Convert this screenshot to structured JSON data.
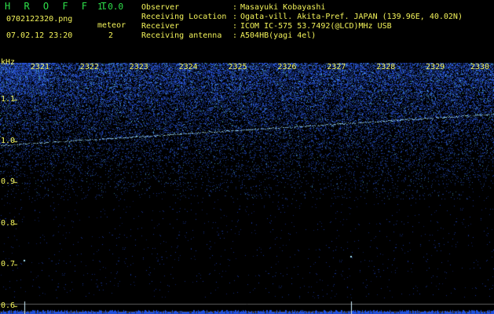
{
  "app": {
    "title": "H R O F F T",
    "version": "1.0.0",
    "file_name": "0702122320.png",
    "datetime": "07.02.12 23:20",
    "meteor_label": "meteor",
    "meteor_count": "2"
  },
  "info": [
    {
      "key": "Observer",
      "sep": ":",
      "value": "Masayuki Kobayashi"
    },
    {
      "key": "Receiving Location",
      "sep": ":",
      "value": "Ogata-vill. Akita-Pref. JAPAN (139.96E, 40.02N)"
    },
    {
      "key": "Receiver",
      "sep": ":",
      "value": "ICOM IC-575 53.7492(@LCD)MHz USB"
    },
    {
      "key": "Receiving antenna",
      "sep": ":",
      "value": "A504HB(yagi 4el)"
    }
  ],
  "chart_data": {
    "type": "heatmap",
    "ylabel": "kHz",
    "y_ticks": [
      "1.1",
      "1.0",
      "0.9",
      "0.8",
      "0.7",
      "0.6"
    ],
    "x_ticks": [
      "2321",
      "2322",
      "2323",
      "2324",
      "2325",
      "2326",
      "2327",
      "2328",
      "2329",
      "2330"
    ],
    "xlim": [
      2320,
      2330
    ],
    "ylim": [
      0.58,
      1.19
    ],
    "carrier_line": {
      "x": [
        2320,
        2330
      ],
      "y": [
        0.99,
        1.066
      ]
    },
    "meteor_echoes": [
      {
        "x": 2320.5,
        "y": 0.71
      },
      {
        "x": 2327.1,
        "y": 0.72
      }
    ],
    "colors": {
      "background": "#000000",
      "noise": "#2a5cff",
      "noise_bright": "#66e0ff",
      "label": "#f3f35a",
      "grid": "#606060",
      "signal": "#a8e8ff"
    }
  }
}
